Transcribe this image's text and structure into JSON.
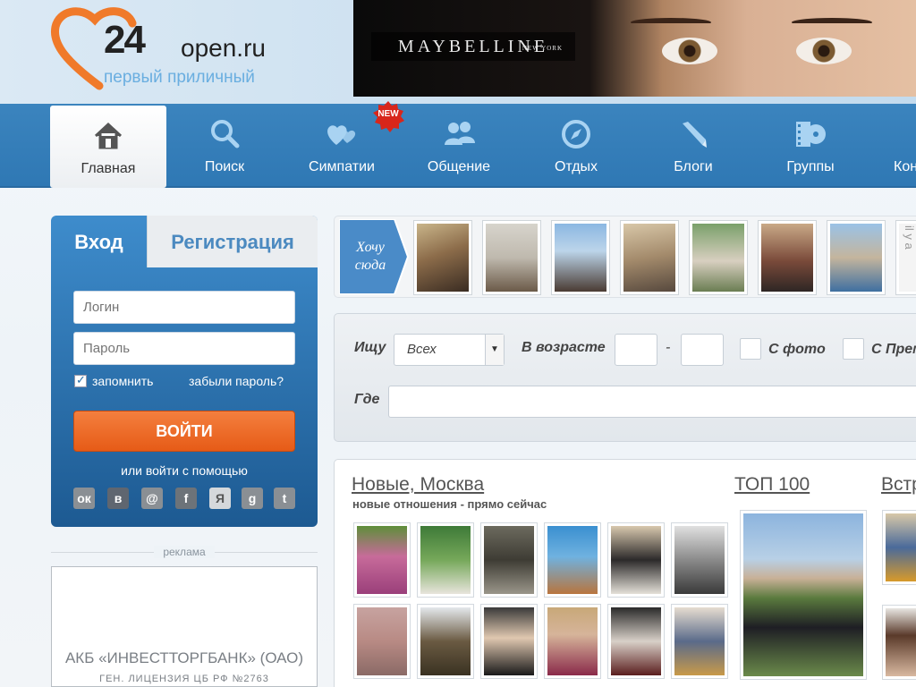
{
  "logo": {
    "number": "24",
    "domain": "open.ru",
    "tagline": "первый приличный"
  },
  "banner": {
    "brand": "MAYBELLINE",
    "brand_sub": "NEW YORK"
  },
  "nav": {
    "items": [
      {
        "label": "Главная",
        "icon": "home-icon"
      },
      {
        "label": "Поиск",
        "icon": "search-icon"
      },
      {
        "label": "Симпатии",
        "icon": "hearts-icon"
      },
      {
        "label": "Общение",
        "icon": "people-icon"
      },
      {
        "label": "Отдых",
        "icon": "compass-icon"
      },
      {
        "label": "Блоги",
        "icon": "pencil-icon"
      },
      {
        "label": "Группы",
        "icon": "film-icon"
      },
      {
        "label": "Кон",
        "icon": ""
      }
    ],
    "new_badge": "NEW"
  },
  "login": {
    "tab_login": "Вход",
    "tab_register": "Регистрация",
    "login_placeholder": "Логин",
    "password_placeholder": "Пароль",
    "remember": "запомнить",
    "forgot": "забыли пароль?",
    "submit": "ВОЙТИ",
    "alt_login": "или войти с помощью",
    "socials": [
      "ok-icon",
      "vk-icon",
      "mail-icon",
      "facebook-icon",
      "yandex-icon",
      "google-icon",
      "twitter-icon"
    ],
    "social_glyphs": [
      "ок",
      "в",
      "@",
      "f",
      "Я",
      "g",
      "t"
    ]
  },
  "ad": {
    "label": "реклама",
    "title": "АКБ «ИНВЕСТТОРГБАНК» (ОАО)",
    "sub": "ГЕН. ЛИЦЕНЗИЯ ЦБ РФ №2763"
  },
  "strip": {
    "want_here": "Хочу сюда",
    "edge_text": "il y a"
  },
  "search": {
    "looking_label": "Ищу",
    "looking_value": "Всех",
    "age_label": "В возрасте",
    "age_dash": "-",
    "with_photo": "С фото",
    "premium": "С Прем",
    "where_label": "Где"
  },
  "content": {
    "new_title": "Новые, Москва",
    "new_sub": "новые отношения - прямо сейчас",
    "top_title": "ТОП 100",
    "meet_title": "Встр"
  },
  "colors": {
    "nav_bg": "#3581bc",
    "login_bg": "#2a6ea9",
    "accent_orange": "#e65b17",
    "logo_heart": "#f07a2a",
    "tagline": "#6aaee0"
  }
}
